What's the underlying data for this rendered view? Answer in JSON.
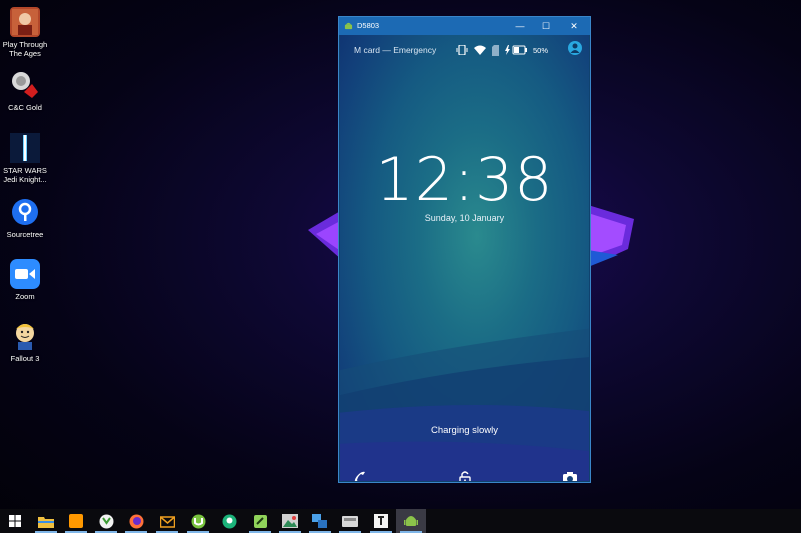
{
  "desktop": {
    "icons": [
      {
        "label": "Play Through The Ages",
        "icon": "play-through-the-ages-icon"
      },
      {
        "label": "C&C Gold",
        "icon": "cnc-gold-icon"
      },
      {
        "label": "STAR WARS Jedi Knight...",
        "icon": "star-wars-icon"
      },
      {
        "label": "Sourcetree",
        "icon": "sourcetree-icon"
      },
      {
        "label": "Zoom",
        "icon": "zoom-icon"
      },
      {
        "label": "Fallout 3",
        "icon": "fallout-3-icon"
      }
    ]
  },
  "window": {
    "title": "D5803",
    "controls": {
      "minimize": "—",
      "maximize": "☐",
      "close": "✕"
    }
  },
  "phone": {
    "carrier": "M card — Emergency",
    "battery": "50%",
    "time": "12:38",
    "date": "Sunday, 10 January",
    "charging": "Charging slowly"
  },
  "taskbar": {
    "items": [
      "start-icon",
      "file-explorer-icon",
      "sublime-text-icon",
      "utorrent-green-icon",
      "firefox-icon",
      "mail-icon",
      "utorrent-icon",
      "gitkraken-icon",
      "notepad-plus-icon",
      "image-viewer-icon",
      "network-icon",
      "disk-tool-icon",
      "typora-icon",
      "android-emulator-icon"
    ]
  },
  "colors": {
    "titlebar": "#1c6ab4",
    "accent": "#29a8e0"
  }
}
